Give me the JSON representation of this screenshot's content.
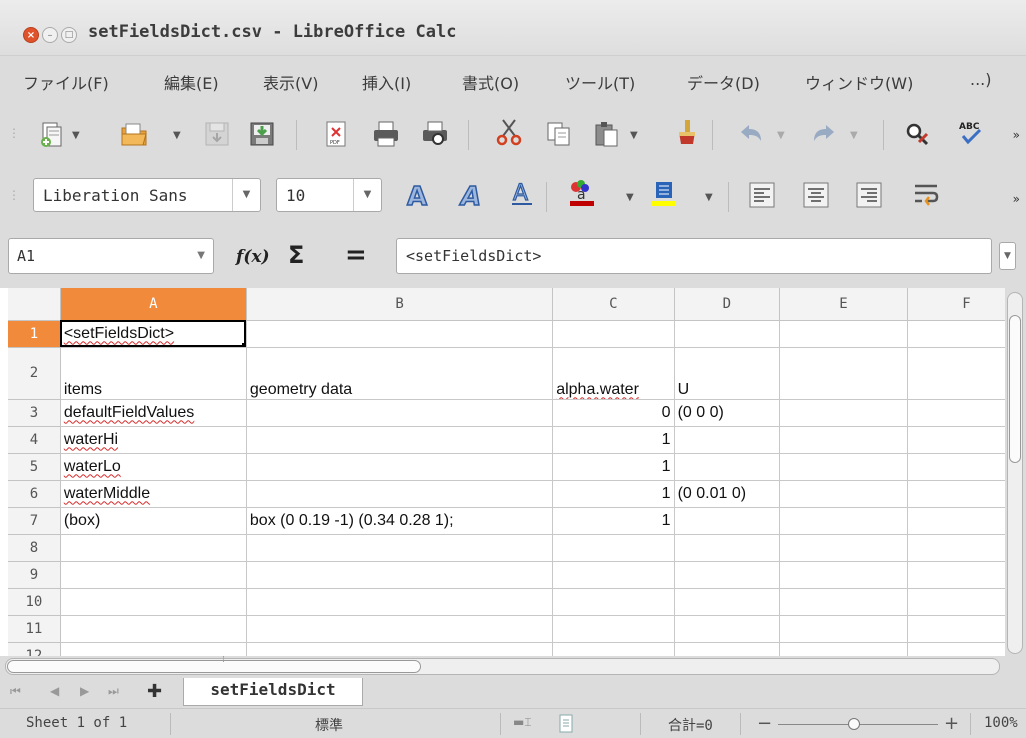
{
  "window": {
    "title": "setFieldsDict.csv - LibreOffice Calc"
  },
  "menu": [
    "ファイル(F)",
    "編集(E)",
    "表示(V)",
    "挿入(I)",
    "書式(O)",
    "ツール(T)",
    "データ(D)",
    "ウィンドウ(W)",
    "...)"
  ],
  "formatting": {
    "font_name": "Liberation Sans",
    "font_size": "10",
    "font_color": "#c00000",
    "highlight_color": "#ffff00"
  },
  "formula_bar": {
    "cell_ref": "A1",
    "content": "<setFieldsDict>"
  },
  "sheet": {
    "columns": [
      "A",
      "B",
      "C",
      "D",
      "E",
      "F"
    ],
    "rows": [
      {
        "num": "1",
        "a": "<setFieldsDict>",
        "b": "",
        "c": "",
        "d": ""
      },
      {
        "num": "2",
        "a": "items",
        "b": "geometry data",
        "c": "alpha.water",
        "d": "U"
      },
      {
        "num": "3",
        "a": "defaultFieldValues",
        "b": "",
        "c": "0",
        "d": "(0 0 0)"
      },
      {
        "num": "4",
        "a": "waterHi",
        "b": "",
        "c": "1",
        "d": ""
      },
      {
        "num": "5",
        "a": "waterLo",
        "b": "",
        "c": "1",
        "d": ""
      },
      {
        "num": "6",
        "a": "waterMiddle",
        "b": "",
        "c": "1",
        "d": "(0 0.01 0)"
      },
      {
        "num": "7",
        "a": "(box)",
        "b": "box (0 0.19 -1) (0.34 0.28 1);",
        "c": "1",
        "d": ""
      },
      {
        "num": "8",
        "a": "",
        "b": "",
        "c": "",
        "d": ""
      },
      {
        "num": "9",
        "a": "",
        "b": "",
        "c": "",
        "d": ""
      },
      {
        "num": "10",
        "a": "",
        "b": "",
        "c": "",
        "d": ""
      },
      {
        "num": "11",
        "a": "",
        "b": "",
        "c": "",
        "d": ""
      },
      {
        "num": "12",
        "a": "",
        "b": "",
        "c": "",
        "d": ""
      }
    ]
  },
  "tabs": {
    "sheet_name": "setFieldsDict"
  },
  "status": {
    "sheet_info": "Sheet 1 of 1",
    "page_style": "標準",
    "sum": "合計=0",
    "zoom": "100%"
  },
  "colors": {
    "selection": "#f28a3c",
    "spell_error": "#d62a2a"
  }
}
